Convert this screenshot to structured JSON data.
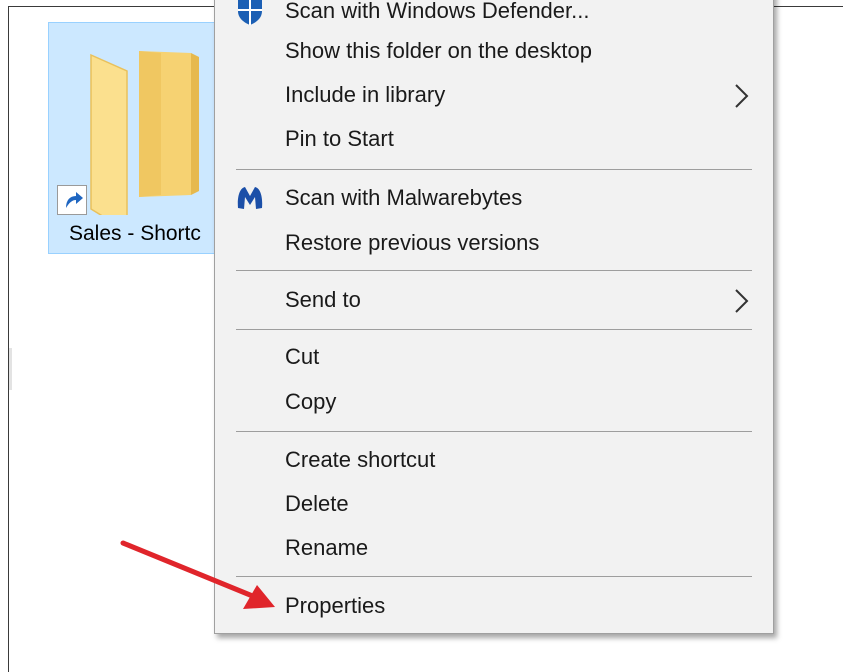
{
  "desktop": {
    "item_label": "Sales - Shortc",
    "folder_color": "#f8d775",
    "selection_color": "#cce8ff",
    "shortcut_icon": "shortcut-arrow-icon"
  },
  "context_menu": {
    "background": "#f2f2f2",
    "items": [
      {
        "label": "Scan with Windows Defender...",
        "icon": "windows-defender-icon"
      },
      {
        "label": "Show this folder on the desktop"
      },
      {
        "label": "Include in library",
        "submenu": true
      },
      {
        "label": "Pin to Start"
      },
      {
        "label": "Scan with Malwarebytes",
        "icon": "malwarebytes-icon"
      },
      {
        "label": "Restore previous versions"
      },
      {
        "label": "Send to",
        "submenu": true
      },
      {
        "label": "Cut"
      },
      {
        "label": "Copy"
      },
      {
        "label": "Create shortcut"
      },
      {
        "label": "Delete"
      },
      {
        "label": "Rename"
      },
      {
        "label": "Properties"
      }
    ]
  },
  "annotation": {
    "arrow_color": "#e0252b",
    "points_to": "Properties"
  }
}
